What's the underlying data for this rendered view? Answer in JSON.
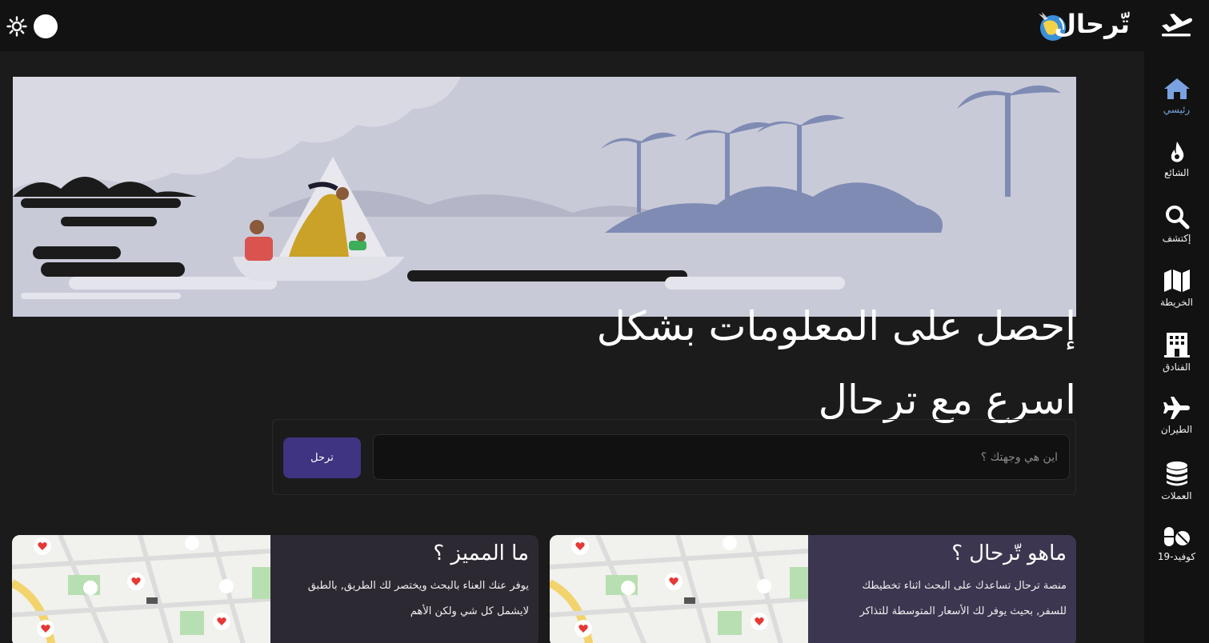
{
  "header": {
    "title": "تّرحال"
  },
  "sidebar": {
    "items": [
      {
        "label": "رئيسي",
        "icon": "home-icon",
        "active": true
      },
      {
        "label": "الشائع",
        "icon": "fire-icon"
      },
      {
        "label": "إكتشف",
        "icon": "search-icon"
      },
      {
        "label": "الخريطة",
        "icon": "map-icon"
      },
      {
        "label": "الفنادق",
        "icon": "hotel-icon"
      },
      {
        "label": "الطيران",
        "icon": "plane-icon"
      },
      {
        "label": "العملات",
        "icon": "coins-icon"
      },
      {
        "label": "كوفيد-19",
        "icon": "pills-icon"
      }
    ]
  },
  "hero": {
    "title_line1": "إحصل على المعلومات بشكل",
    "title_line2": "اسرع مع ترحال"
  },
  "search": {
    "placeholder": "اين هي وجهتك ؟",
    "button_label": "ترحل"
  },
  "cards": [
    {
      "title": "ماهو تّرحال ؟",
      "line1": "منصة ترحال تساعدك على البحث اثناء تخطيطك",
      "line2": "للسفر, بحيث يوفر لك الأسعار المتوسطة للتذاكر"
    },
    {
      "title": "ما المميز ؟",
      "line1": "يوفر عنك العناء بالبحث ويختصر لك الطريق, بالطبق",
      "line2": "لايشمل كل شي ولكن الأهم"
    }
  ],
  "colors": {
    "accent": "#3e3481",
    "sidebar_active": "#7aa2e0",
    "card_right_bg": "#3c3650",
    "card_left_bg": "#2d2933"
  }
}
